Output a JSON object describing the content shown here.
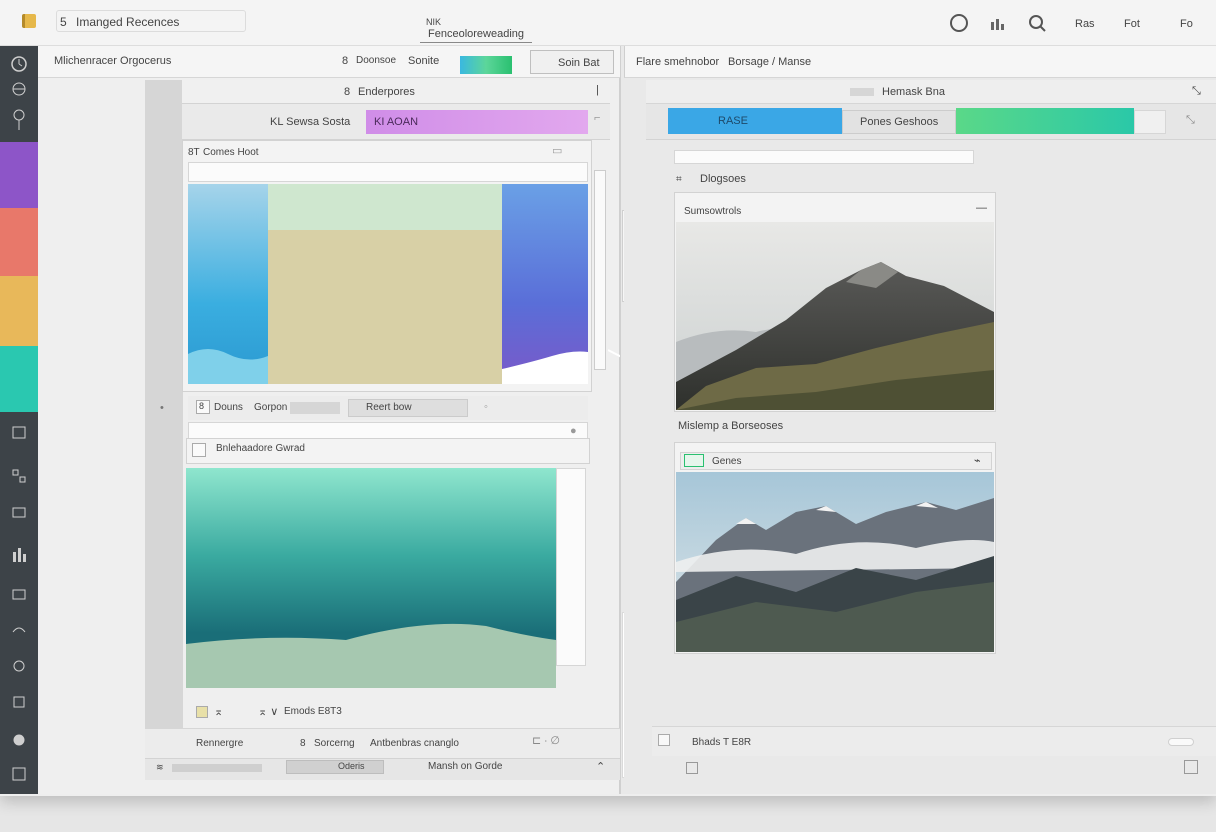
{
  "titlebar": {
    "title": "Imanged Recences",
    "center_top": "NIK",
    "center_main": "Fenceoloreweading",
    "right_items": [
      "Ras",
      "Fot",
      "Fo"
    ],
    "prefix": "5"
  },
  "left": {
    "header_title": "Mlichenracer Orgocerus",
    "header_prefix": "8",
    "header_mid": "Doonsoe",
    "header_mid2": "Sonite",
    "header_button": "Soin Bat",
    "sub_header": "Enderpores",
    "sub_header_prefix": "8",
    "filter_label": "KL Sewsa Sosta",
    "filter_pill": "KI AOAN",
    "card1_title": "Comes Hoot",
    "card1_prefix": "8T",
    "row1_label": "Douns",
    "row1_mid": "Gorpon",
    "row1_right": "Reert bow",
    "row1_prefix": "8",
    "card2_title": "Bnlehaadore Gwrad",
    "foot_icons_text": "Emods E8T3",
    "bottom_left": "Rennergre",
    "bottom_mid_prefix": "8",
    "bottom_mid": "Sorcerng",
    "bottom_right": "Antbenbras cnanglo",
    "status_center": "Mansh on Gorde",
    "status_box": "Oderis"
  },
  "right": {
    "header_title": "Flare smehnobor",
    "header_mid": "Borsage / Manse",
    "sub_header": "Hemask Bna",
    "tab_blue": "RASE",
    "tab_mid": "Pones Geshoos",
    "section_label": "Dlogsoes",
    "card1_title": "Sumsowtrols",
    "caption": "Mislemp a Borseoses",
    "card2_title": "Genes",
    "footer_label": "Bhads T E8R"
  },
  "colors": {
    "swatches": [
      "#8d55c8",
      "#e8786a",
      "#e8b85a",
      "#2ac8b0"
    ],
    "blue_tab": "#3aa7e6",
    "green_tab": "#3ccc90",
    "pill": "#d49ae8",
    "rail": "#3d4348"
  },
  "icons": [
    "clock-icon",
    "globe-icon",
    "lock-icon",
    "user-icon",
    "grid-icon",
    "chart-icon",
    "layers-icon",
    "link-icon",
    "home-icon",
    "settings-icon"
  ]
}
